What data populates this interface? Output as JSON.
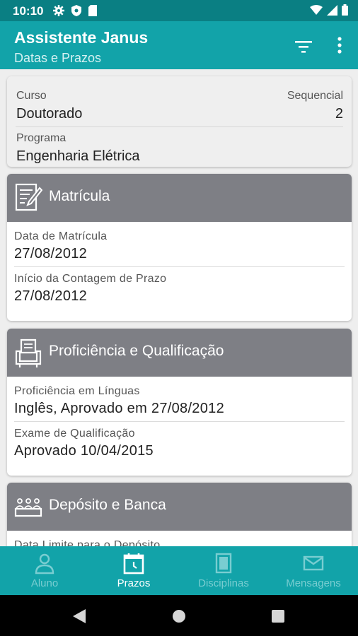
{
  "status_bar": {
    "time": "10:10"
  },
  "app_bar": {
    "title": "Assistente Janus",
    "subtitle": "Datas e Prazos"
  },
  "summary": {
    "curso_label": "Curso",
    "curso_value": "Doutorado",
    "sequencial_label": "Sequencial",
    "sequencial_value": "2",
    "programa_label": "Programa",
    "programa_value": "Engenharia Elétrica"
  },
  "cards": {
    "matricula": {
      "title": "Matrícula",
      "fields": [
        {
          "label": "Data de Matrícula",
          "value": "27/08/2012"
        },
        {
          "label": "Início da Contagem de Prazo",
          "value": "27/08/2012"
        }
      ]
    },
    "proficiencia": {
      "title": "Proficiência e Qualificação",
      "fields": [
        {
          "label": "Proficiência em Línguas",
          "value": "Inglês, Aprovado em 27/08/2012"
        },
        {
          "label": "Exame de Qualificação",
          "value": "Aprovado 10/04/2015"
        }
      ]
    },
    "deposito": {
      "title": "Depósito e Banca",
      "fields": [
        {
          "label": "Data Limite para o Depósito"
        }
      ]
    }
  },
  "bottom_nav": {
    "items": [
      {
        "label": "Aluno",
        "icon": "person-icon"
      },
      {
        "label": "Prazos",
        "icon": "calendar-clock-icon",
        "active": true
      },
      {
        "label": "Disciplinas",
        "icon": "books-icon"
      },
      {
        "label": "Mensagens",
        "icon": "mail-icon"
      }
    ]
  },
  "colors": {
    "status_bar": "#0a7f83",
    "primary": "#12a3a9",
    "card_header": "#7e7f85",
    "nav_inactive": "#79cdd1"
  }
}
